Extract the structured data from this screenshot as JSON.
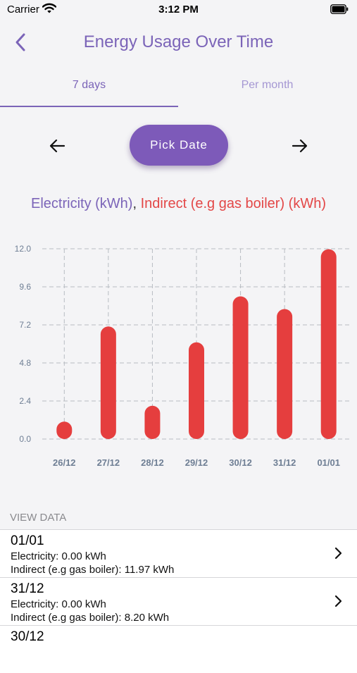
{
  "status_bar": {
    "carrier": "Carrier",
    "time": "3:12 PM"
  },
  "header": {
    "title": "Energy Usage Over Time"
  },
  "tabs": [
    {
      "label": "7 days",
      "active": true
    },
    {
      "label": "Per month",
      "active": false
    }
  ],
  "date_nav": {
    "pick_date_label": "Pick Date"
  },
  "legend": {
    "electricity": "Electricity (kWh)",
    "separator": ",",
    "indirect": "Indirect (e.g gas boiler) (kWh)"
  },
  "colors": {
    "accent": "#7b64b8",
    "button": "#7d5ab9",
    "indirect": "#e53e3e"
  },
  "chart_data": {
    "type": "bar",
    "categories": [
      "26/12",
      "27/12",
      "28/12",
      "29/12",
      "30/12",
      "31/12",
      "01/01"
    ],
    "series": [
      {
        "name": "Electricity (kWh)",
        "values": [
          0,
          0,
          0,
          0,
          0,
          0,
          0
        ]
      },
      {
        "name": "Indirect (e.g gas boiler) (kWh)",
        "values": [
          1.1,
          7.1,
          2.1,
          6.1,
          9.0,
          8.2,
          11.97
        ]
      }
    ],
    "ylim": [
      0,
      12
    ],
    "y_ticks": [
      "0.0",
      "2.4",
      "4.8",
      "7.2",
      "9.6",
      "12.0"
    ],
    "grid": true
  },
  "view_data": {
    "label": "VIEW DATA",
    "rows": [
      {
        "date": "01/01",
        "electricity": "Electricity: 0.00 kWh",
        "indirect": "Indirect (e.g gas boiler): 11.97 kWh"
      },
      {
        "date": "31/12",
        "electricity": "Electricity: 0.00 kWh",
        "indirect": "Indirect (e.g gas boiler): 8.20 kWh"
      },
      {
        "date": "30/12"
      }
    ]
  }
}
